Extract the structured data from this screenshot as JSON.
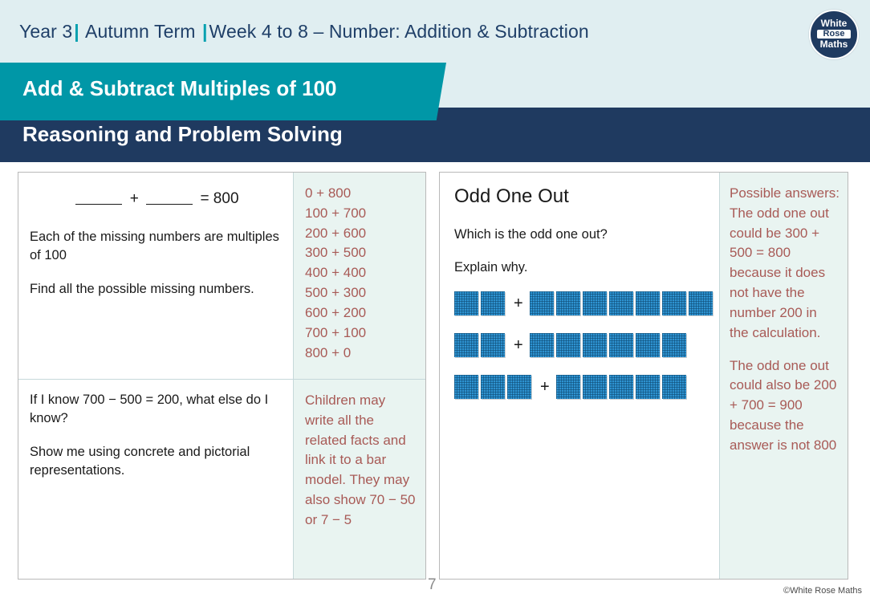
{
  "header": {
    "year": "Year 3",
    "term": "Autumn Term",
    "week": "Week 4 to 8 – Number: Addition & Subtraction",
    "separator": "|",
    "logo": {
      "line1": "White",
      "line2": "Rose",
      "line3": "Maths"
    },
    "lesson_title": "Add & Subtract Multiples of 100",
    "section_title": "Reasoning and Problem Solving"
  },
  "left_panel": {
    "q1": {
      "equation_suffix": "= 800",
      "plus": "+",
      "line1": "Each of the missing numbers are multiples of 100",
      "line2": "Find all the possible missing numbers.",
      "answers": [
        "0 + 800",
        "100 + 700",
        "200 + 600",
        "300 + 500",
        "400 + 400",
        "500 + 300",
        "600 + 200",
        "700 + 100",
        "800 + 0"
      ]
    },
    "q2": {
      "line1": "If I know 700 − 500 = 200, what else do I know?",
      "line2": "Show me using concrete and pictorial representations.",
      "answer": "Children may write all the related facts and link it to a bar model. They may also show 70 − 50 or 7 − 5"
    }
  },
  "right_panel": {
    "title": "Odd One Out",
    "prompt1": "Which is the odd one out?",
    "prompt2": "Explain why.",
    "plus": "+",
    "block_rows": [
      {
        "left_count": 2,
        "right_count": 7,
        "calculation": "200 + 700"
      },
      {
        "left_count": 2,
        "right_count": 6,
        "calculation": "200 + 600"
      },
      {
        "left_count": 3,
        "right_count": 5,
        "calculation": "300 + 500"
      }
    ],
    "answer_p1": "Possible answers: The odd one out could be 300 + 500 = 800 because it does not have the number 200 in the calculation.",
    "answer_p2": "The odd one out could also be 200 + 700 = 900 because the answer is not 800"
  },
  "footer": {
    "page_number": "7",
    "copyright": "©White Rose Maths"
  },
  "colors": {
    "header_bg": "#e0eef1",
    "teal": "#0097a7",
    "navy": "#1f3a60",
    "answer_bg": "#e9f4f1",
    "answer_text": "#a85a56",
    "block_blue": "#2e93d1"
  }
}
